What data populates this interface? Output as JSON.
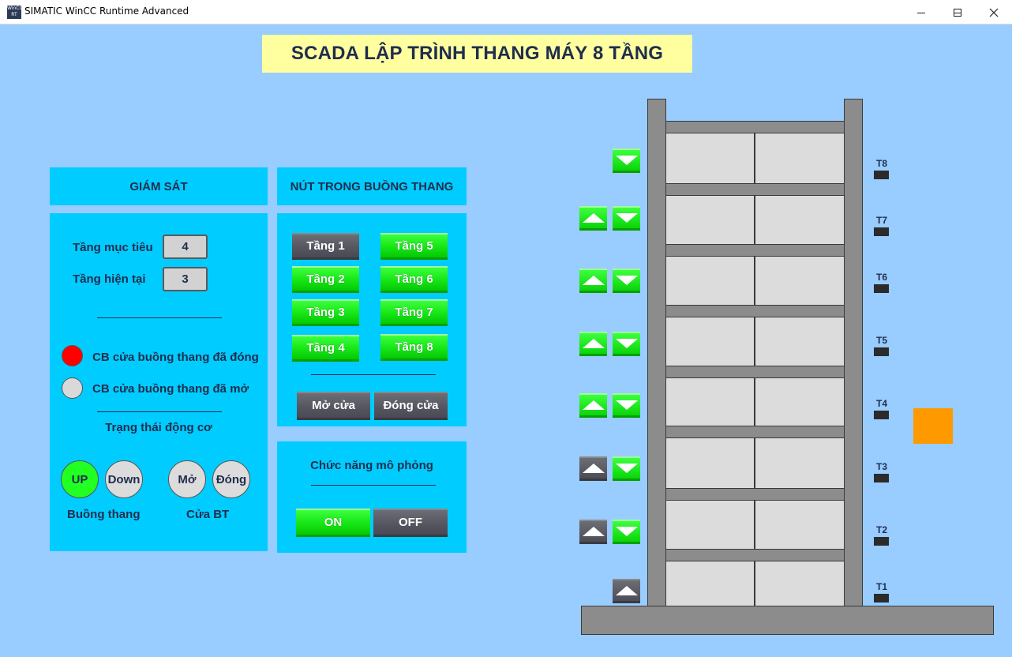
{
  "window": {
    "title": "SIMATIC WinCC Runtime Advanced",
    "app_icon_text": "WinCC RT"
  },
  "banner": "SCADA LẬP TRÌNH THANG MÁY 8 TẦNG",
  "monitor": {
    "title": "GIÁM SÁT",
    "target_floor_label": "Tầng mục tiêu",
    "target_floor_value": "4",
    "current_floor_label": "Tầng hiện tại",
    "current_floor_value": "3",
    "door_closed_label": "CB cửa buồng thang đã đóng",
    "door_closed_color": "#ff0000",
    "door_open_label": "CB cửa buồng thang đã mở",
    "door_open_color": "#d9d9d9",
    "motor_status_title": "Trạng thái động cơ",
    "up_label": "UP",
    "up_color": "#22ff22",
    "down_label": "Down",
    "open_label": "Mở",
    "close_label": "Đóng",
    "cabin_label": "Buồng thang",
    "door_label": "Cửa BT"
  },
  "cabin_buttons": {
    "title": "NÚT TRONG BUỒNG THANG",
    "floors": [
      {
        "label": "Tầng 1",
        "state": "gray"
      },
      {
        "label": "Tầng 2",
        "state": "green"
      },
      {
        "label": "Tầng 3",
        "state": "green"
      },
      {
        "label": "Tầng 4",
        "state": "green"
      },
      {
        "label": "Tầng 5",
        "state": "green"
      },
      {
        "label": "Tầng 6",
        "state": "green"
      },
      {
        "label": "Tầng 7",
        "state": "green"
      },
      {
        "label": "Tầng 8",
        "state": "green"
      }
    ],
    "open_door": "Mở cửa",
    "close_door": "Đóng cửa"
  },
  "simulation": {
    "title": "Chức năng mô phỏng",
    "on_label": "ON",
    "off_label": "OFF"
  },
  "shaft": {
    "floor_labels": [
      "T8",
      "T7",
      "T6",
      "T5",
      "T4",
      "T3",
      "T2",
      "T1"
    ],
    "cabin_color": "#ff9900",
    "cabin_floor": "T4",
    "hall_calls": [
      {
        "floor": "T8",
        "up": null,
        "down": "green"
      },
      {
        "floor": "T7",
        "up": "green",
        "down": "green"
      },
      {
        "floor": "T6",
        "up": "green",
        "down": "green"
      },
      {
        "floor": "T5",
        "up": "green",
        "down": "green"
      },
      {
        "floor": "T4",
        "up": "green",
        "down": "green"
      },
      {
        "floor": "T3",
        "up": "gray",
        "down": "green"
      },
      {
        "floor": "T2",
        "up": "gray",
        "down": "green"
      },
      {
        "floor": "T1",
        "up": "gray",
        "down": null
      }
    ]
  }
}
